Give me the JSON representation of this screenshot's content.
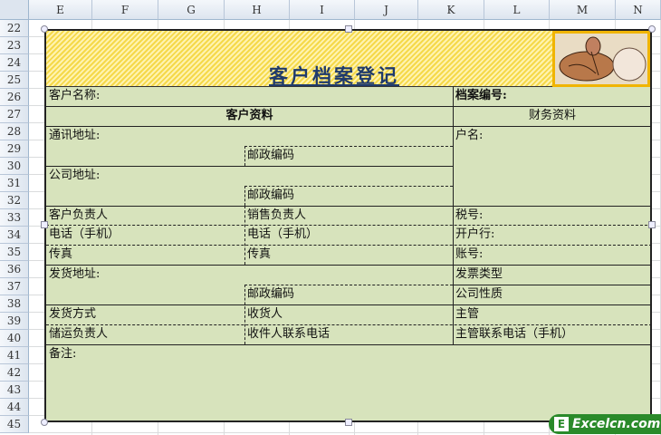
{
  "sheet": {
    "columns": [
      "E",
      "F",
      "G",
      "H",
      "I",
      "J",
      "K",
      "L",
      "M",
      "N"
    ],
    "rows": [
      "22",
      "23",
      "24",
      "25",
      "26",
      "27",
      "28",
      "29",
      "30",
      "31",
      "32",
      "33",
      "34",
      "35",
      "36",
      "37",
      "38",
      "39",
      "40",
      "41",
      "42",
      "43",
      "44",
      "45"
    ]
  },
  "form": {
    "title": "客户档案登记",
    "customer_name": "客户名称:",
    "file_no": "档案编号:",
    "section_customer": "客户资料",
    "section_finance": "财务资料",
    "comm_address": "通讯地址:",
    "postal1": "邮政编码",
    "company_address": "公司地址:",
    "postal2": "邮政编码",
    "account_name": "户名:",
    "customer_manager": "客户负责人",
    "sales_manager": "销售负责人",
    "tax_no": "税号:",
    "phone1": "电话（手机）",
    "phone2": "电话（手机）",
    "bank": "开户行:",
    "fax1": "传真",
    "fax2": "传真",
    "account_no": "账号:",
    "ship_address": "发货地址:",
    "invoice_type": "发票类型",
    "postal3": "邮政编码",
    "company_type": "公司性质",
    "ship_method": "发货方式",
    "receiver": "收货人",
    "supervisor": "主管",
    "logistics_manager": "储运负责人",
    "receiver_phone": "收件人联系电话",
    "supervisor_phone": "主管联系电话（手机）",
    "remarks": "备注:"
  },
  "watermark": {
    "letter": "E",
    "text": "Excelcn.com"
  }
}
